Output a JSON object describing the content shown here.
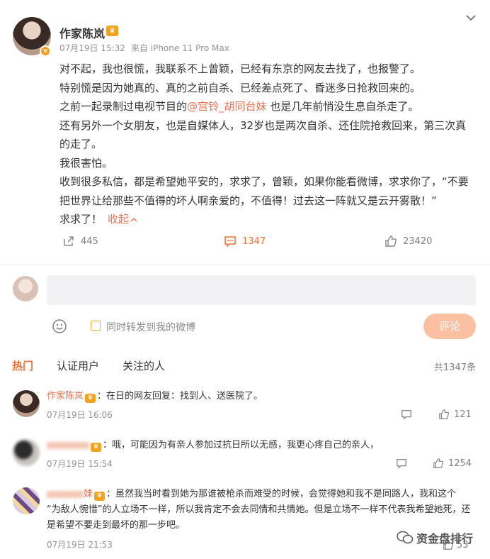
{
  "post": {
    "author": "作家陈岚",
    "date": "07月19日 15:32",
    "source": "来自 iPhone 11 Pro Max",
    "lines": [
      "对不起，我也很慌，我联系不上曾颖，已经有东京的网友去找了，也报警了。",
      "特别慌是因为她真的、真的之前自杀、已经差点死了、昏迷多日抢救回来的。",
      "之前一起录制过电视节目的",
      "也是几年前悄没生息自杀走了。",
      "还有另外一个女朋友，也是自媒体人，32岁也是两次自杀、还住院抢救回来，第三次真",
      "的走了。",
      "我很害怕。",
      "收到很多私信，都是希望她平安的，求求了，曾颖，如果你能看微博，求求你了，“不要",
      "把世界让给那些不值得的坏人啊亲爱的，不值得！过去这一阵就又是云开雾散！”",
      "求求了！"
    ],
    "mention": "@宫铃_胡同台妹",
    "fold_label": "收起",
    "repost_count": "445",
    "comment_count": "1347",
    "like_count": "23420"
  },
  "composer": {
    "forward_label": "同时转发到我的微博",
    "submit_label": "评论"
  },
  "tabs": [
    "热门",
    "认证用户",
    "关注的人"
  ],
  "total_label": "共1347条",
  "comments": [
    {
      "name": "作家陈岚",
      "text": "：在日的网友回复：找到人、送医院了。",
      "date": "07月19日 16:06",
      "likes": "121"
    },
    {
      "name": "",
      "text": "：哦，可能因为有亲人参加过抗日所以无感，我更心疼自己的亲人，",
      "date": "07月19日 15:54",
      "likes": "1254"
    },
    {
      "name": "妹",
      "text1": "：虽然我当时看到她为那谁被枪杀而难受的时候，会觉得她和我不是同路人，我和这个",
      "text2": "“为敌人惋惜”的人立场不一样，所以我肯定不会去同情和共情她。但是立场不一样不代表我希望她死，还",
      "text3": "是希望不要走到最坏的那一步吧。",
      "date": "07月19日 21:53",
      "likes": "53"
    }
  ],
  "watermark": "资金盘排行",
  "colors": {
    "accent": "#f26e31",
    "link": "#eb7350",
    "muted": "#939393",
    "submit_bg": "#fbbfa2"
  }
}
